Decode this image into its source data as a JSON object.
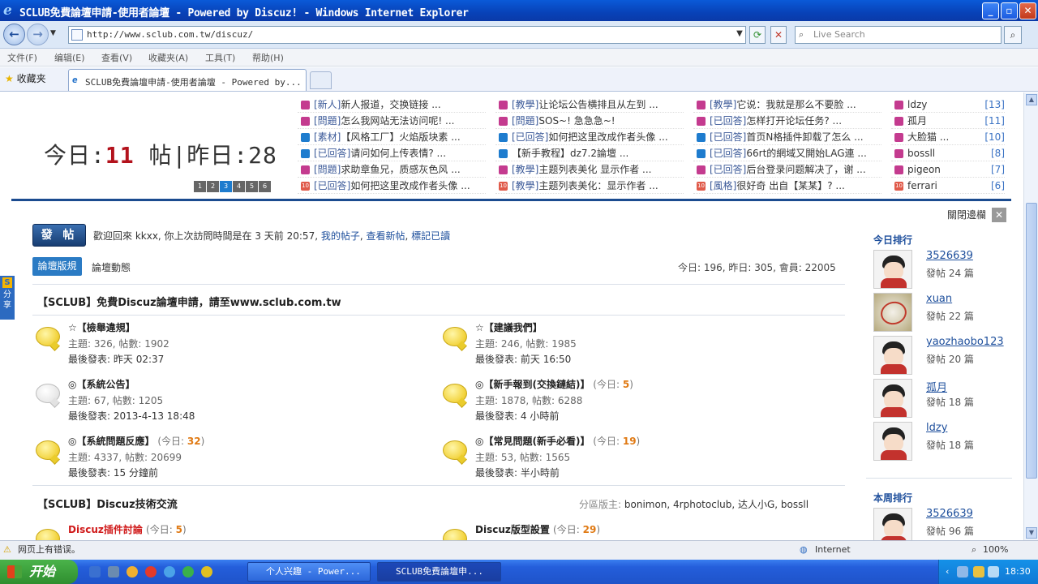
{
  "window": {
    "title": "SCLUB免費論壇申請-使用者論壇 - Powered by Discuz! - Windows Internet Explorer"
  },
  "address": {
    "url": "http://www.sclub.com.tw/discuz/",
    "search_placeholder": "Live Search"
  },
  "menu": [
    "文件(F)",
    "编辑(E)",
    "查看(V)",
    "收藏夹(A)",
    "工具(T)",
    "帮助(H)"
  ],
  "favorites": {
    "label": "收藏夹",
    "tab_title": "SCLUB免費論壇申請-使用者論壇 - Powered by..."
  },
  "stats": {
    "today_label": "今日:",
    "today_count": "11",
    "today_unit": "帖",
    "yesterday_label": "|昨日:28",
    "pages": [
      "1",
      "2",
      "3",
      "4",
      "5",
      "6"
    ],
    "active_page": 3
  },
  "threads": [
    [
      {
        "tag": "[新人]",
        "text": "新人报道，交换链接 ..."
      },
      {
        "tag": "[問題]",
        "text": "怎么我网站无法访问呢! ..."
      },
      {
        "tag": "[素材]",
        "text": "【风格工厂】火焰版块素 ..."
      },
      {
        "tag": "[已回答]",
        "text": "请问如何上传表情? ..."
      },
      {
        "tag": "[問題]",
        "text": "求助章鱼兄，质感灰色风 ..."
      },
      {
        "tag": "[已回答]",
        "text": "如何把这里改成作者头像 ..."
      }
    ],
    [
      {
        "tag": "[教學]",
        "text": "让论坛公告横排且从左到 ..."
      },
      {
        "tag": "[問題]",
        "text": "SOS~! 急急急~!"
      },
      {
        "tag": "[已回答]",
        "text": "如何把这里改成作者头像 ..."
      },
      {
        "tag": "",
        "text": "【新手教程】dz7.2論壇 ..."
      },
      {
        "tag": "[教學]",
        "text": "主题列表美化 显示作者 ..."
      },
      {
        "tag": "[教學]",
        "text": "主题列表美化：显示作者 ..."
      }
    ],
    [
      {
        "tag": "[教學]",
        "text": "它说：我就是那么不要脸 ..."
      },
      {
        "tag": "[已回答]",
        "text": "怎样打开论坛任务? ..."
      },
      {
        "tag": "[已回答]",
        "text": "首页N格插件卸载了怎么 ..."
      },
      {
        "tag": "[已回答]",
        "text": "66rt的網域又開始LAG連 ..."
      },
      {
        "tag": "[已回答]",
        "text": "后台登录问题解决了，谢 ..."
      },
      {
        "tag": "[風格]",
        "text": "很好奇 出自【某某】? ..."
      }
    ]
  ],
  "top_posters": [
    {
      "name": "ldzy",
      "count": "[13]"
    },
    {
      "name": "孤月",
      "count": "[11]"
    },
    {
      "name": "大脸猫 ...",
      "count": "[10]"
    },
    {
      "name": "bossll",
      "count": "[8]"
    },
    {
      "name": "pigeon",
      "count": "[7]"
    },
    {
      "name": "ferrari",
      "count": "[6]"
    }
  ],
  "main": {
    "post_button": "發 帖",
    "welcome": "歡迎回來 kkxx, 你上次訪問時間是在 3 天前 20:57,",
    "link_myposts": "我的帖子",
    "link_newposts": "查看新帖",
    "link_markread": "標記已讀",
    "rules_button": "論壇版規",
    "dynamics": "論壇動態",
    "site_stats": "今日: 196, 昨日: 305, 會員: 22005"
  },
  "section1": {
    "title": "【SCLUB】免費Discuz論壇申請，請至www.sclub.com.tw"
  },
  "forums": [
    {
      "name": "☆【檢舉違規】",
      "today": "",
      "l2": "主題: 326, 帖數: 1902",
      "l3_label": "最後發表:",
      "l3_value": "昨天 02:37",
      "gray": false
    },
    {
      "name": "☆【建議我們】",
      "today": "",
      "l2": "主題: 246, 帖數: 1985",
      "l3_label": "最後發表:",
      "l3_value": "前天 16:50",
      "gray": false
    },
    {
      "name": "◎【系統公告】",
      "today": "",
      "l2": "主題: 67, 帖數: 1205",
      "l3_label": "最後發表:",
      "l3_value": "2013-4-13 18:48",
      "gray": true
    },
    {
      "name": "◎【新手報到(交換鏈結)】",
      "today": "5",
      "l2": "主題: 1878, 帖數: 6288",
      "l3_label": "最後發表:",
      "l3_value": "4 小時前",
      "gray": false
    },
    {
      "name": "◎【系統問題反應】",
      "today": "32",
      "l2": "主題: 4337, 帖數: 20699",
      "l3_label": "最後發表:",
      "l3_value": "15 分鐘前",
      "gray": false
    },
    {
      "name": "◎【常見問題(新手必看)】",
      "today": "19",
      "l2": "主題: 53, 帖數: 1565",
      "l3_label": "最後發表:",
      "l3_value": "半小時前",
      "gray": false
    }
  ],
  "section2": {
    "title": "【SCLUB】Discuz技術交流",
    "mods_label": "分區版主:",
    "mods": "bonimon, 4rphotoclub, 达人小G, bossll"
  },
  "forums2": [
    {
      "name": "Discuz插件討論",
      "today": "5"
    },
    {
      "name": "Discuz版型設置",
      "today": "29"
    }
  ],
  "sidebar": {
    "close_label": "關閉邊欄",
    "today_rank": "今日排行",
    "week_rank": "本周排行",
    "today": [
      {
        "name": "3526639",
        "posts": "發帖 24 篇"
      },
      {
        "name": "xuan",
        "posts": "發帖 22 篇"
      },
      {
        "name": "yaozhaobo123",
        "posts": "發帖 20 篇"
      },
      {
        "name": "孤月",
        "posts": "發帖 18 篇"
      },
      {
        "name": "ldzy",
        "posts": "發帖 18 篇"
      }
    ],
    "week": [
      {
        "name": "3526639",
        "posts": "發帖 96 篇"
      }
    ]
  },
  "share": "分享",
  "statusbar": {
    "text": "网页上有错误。",
    "zone": "Internet",
    "zoom": "100%"
  },
  "taskbar": {
    "start": "开始",
    "tasks": [
      "个人兴趣 - Power...",
      "SCLUB免費論壇申..."
    ],
    "clock": "18:30"
  },
  "today_prefix": "(今日:",
  "today_suffix": ")"
}
